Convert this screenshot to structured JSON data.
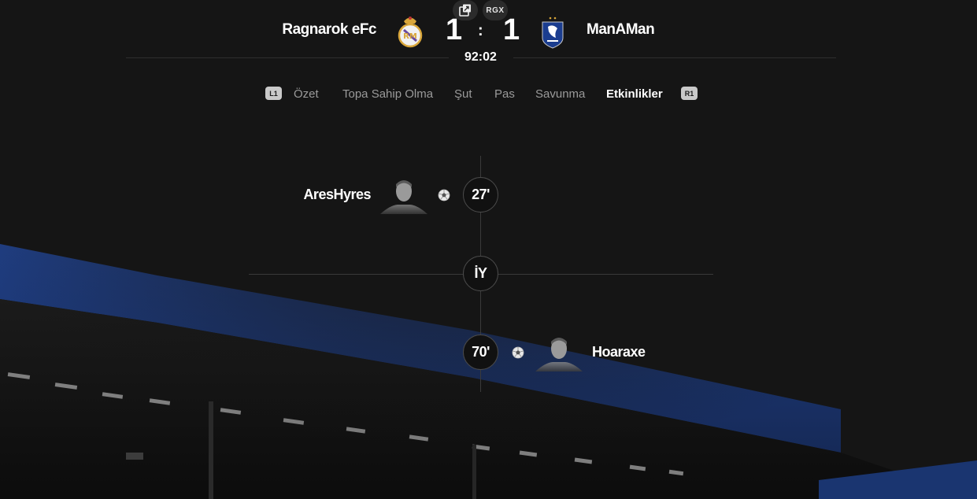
{
  "header": {
    "top_badge": "RGX",
    "home_team": "Ragnarok eFc",
    "away_team": "ManAMan",
    "home_score": "1",
    "away_score": "1",
    "separator": ":",
    "clock": "92:02"
  },
  "tabs": {
    "left_button": "L1",
    "right_button": "R1",
    "items": [
      {
        "label": "Özet"
      },
      {
        "label": "Topa Sahip Olma"
      },
      {
        "label": "Şut"
      },
      {
        "label": "Pas"
      },
      {
        "label": "Savunma"
      },
      {
        "label": "Etkinlikler"
      }
    ],
    "active": "Etkinlikler"
  },
  "events": [
    {
      "side": "home",
      "type": "goal",
      "minute": "27'",
      "player": "AresHyres"
    },
    {
      "side": "divider",
      "label": "İY"
    },
    {
      "side": "away",
      "type": "goal",
      "minute": "70'",
      "player": "Hoaraxe"
    }
  ],
  "colors": {
    "background": "#151515",
    "stadium_blue": "#1f3f86",
    "text_primary": "#ffffff",
    "text_muted": "#9a9a9a"
  }
}
